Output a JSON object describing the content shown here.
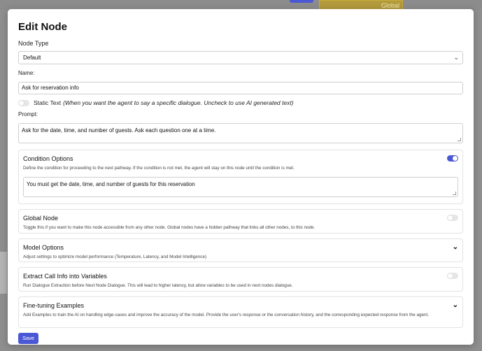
{
  "background": {
    "global_badge": "Global"
  },
  "modal": {
    "title": "Edit Node",
    "node_type_label": "Node Type",
    "node_type_value": "Default",
    "name_label": "Name:",
    "name_value": "Ask for reservation info",
    "static_text_label": "Static Text",
    "static_text_hint": "(When you want the agent to say a specific dialogue. Uncheck to use AI generated text)",
    "prompt_label": "Prompt:",
    "prompt_value": "Ask for the date, time, and number of guests. Ask each question one at a time.",
    "sections": {
      "condition": {
        "title": "Condition Options",
        "description": "Define the condition for proceeding to the next pathway. If the condition is not met, the agent will stay on this node until the condition is met.",
        "value": "You must get the date, time, and number of guests for this reservation",
        "enabled": true
      },
      "global": {
        "title": "Global Node",
        "description": "Toggle this if you want to make this node accessible from any other node. Global nodes have a hidden pathway that links all other nodes, to this node.",
        "enabled": false
      },
      "model": {
        "title": "Model Options",
        "description": "Adjust settings to optimize model performance (Temperature, Latency, and Model Intelligence)"
      },
      "extract": {
        "title": "Extract Call Info into Variables",
        "description": "Run Dialogue Extraction before Next Node Dialogue. This will lead to higher latency, but allow variables to be used in next nodes dialogue.",
        "enabled": false
      },
      "finetune": {
        "title": "Fine-tuning Examples",
        "description": "Add Examples to train the AI on handling edge-cases and improve the accuracy of the model. Provide the user's response or the conversation history, and the corresponding expected response from the agent."
      }
    },
    "save_label": "Save"
  },
  "icons": {
    "select_chevron": "chevron-down-icon",
    "section_chevron": "chevron-down-icon"
  },
  "colors": {
    "accent": "#4b58d6",
    "overlay": "#8f8f8f"
  }
}
